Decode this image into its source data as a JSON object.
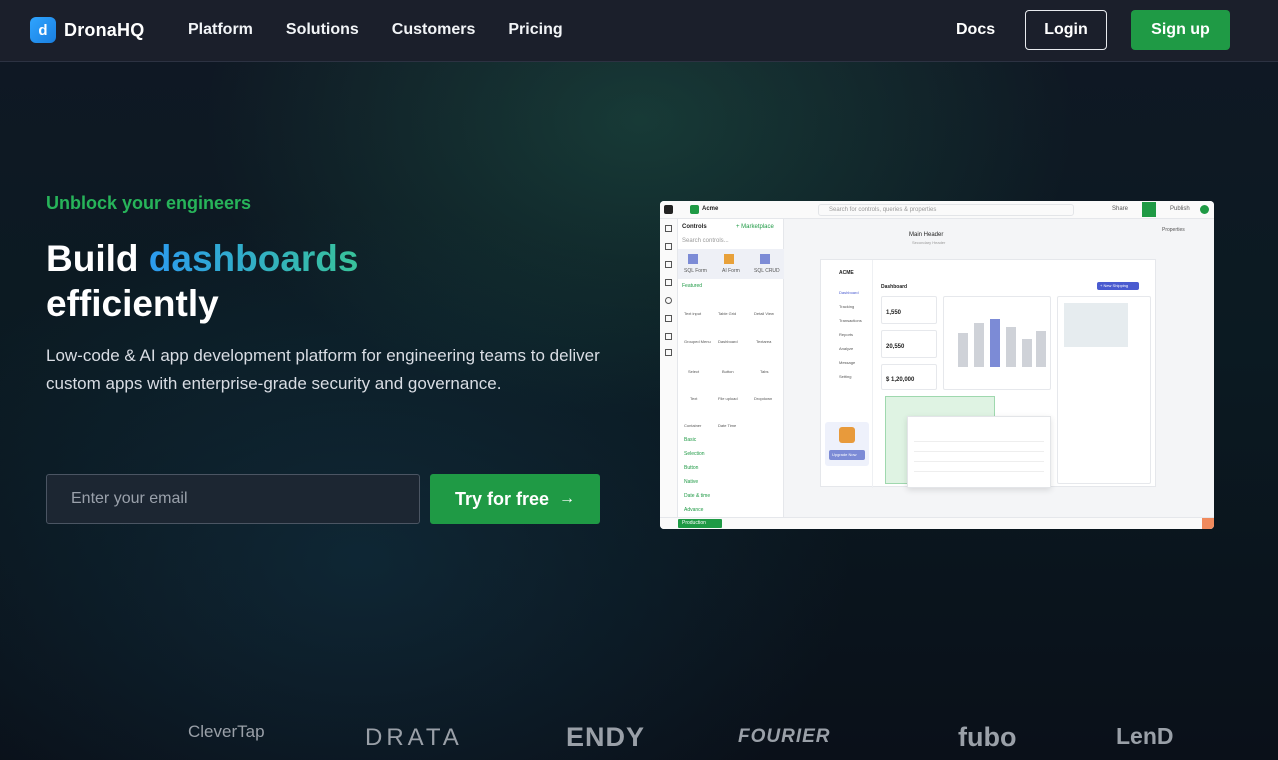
{
  "brand": {
    "name": "DronaHQ"
  },
  "nav": {
    "links": [
      "Platform",
      "Solutions",
      "Customers",
      "Pricing"
    ],
    "docs": "Docs",
    "login": "Login",
    "signup": "Sign up"
  },
  "hero": {
    "eyebrow": "Unblock your engineers",
    "headline_part1": "Build",
    "headline_accent": "dashboards",
    "headline_part2": "efficiently",
    "subtext": "Low-code & AI app development platform for engineering teams to deliver custom apps with enterprise-grade security and governance.",
    "email_placeholder": "Enter your email",
    "cta": "Try for free",
    "cta_arrow": "→"
  },
  "mock": {
    "workspace": "Acme",
    "search": "Search for controls, queries & properties",
    "share": "Share",
    "publish": "Publish",
    "controls": "Controls",
    "marketplace": "+ Marketplace",
    "search_controls": "Search controls...",
    "properties": "Properties",
    "main_header": "Main Header",
    "secondary_header": "Secondary Header",
    "tiles": [
      "SQL Form",
      "AI Form",
      "SQL CRUD"
    ],
    "featured": "Featured",
    "featured_items": [
      "Text input",
      "Table Grid",
      "Detail View",
      "Grouped Menu",
      "Dashboard",
      "Textarea",
      "Select",
      "Button",
      "Tabs",
      "Text",
      "File upload",
      "Dropdown",
      "Container",
      "Date Time"
    ],
    "sections": [
      "Basic",
      "Selection",
      "Button",
      "Native",
      "Date & time",
      "Advance"
    ],
    "app_name": "ACME",
    "app_menu": [
      "Dashboard",
      "Tracking",
      "Transactions",
      "Reports",
      "Analyze",
      "Message",
      "Setting"
    ],
    "dashboard_title": "Dashboard",
    "new_shipping": "+ New Shipping",
    "stat1": "1,550",
    "stat2": "20,550",
    "stat3": "$ 1,20,000",
    "upgrade": "Upgrade Now",
    "production": "Production"
  },
  "logos": [
    "CleverTap",
    "DRATA",
    "ENDY",
    "FOURIER",
    "fubo",
    "LenD"
  ]
}
